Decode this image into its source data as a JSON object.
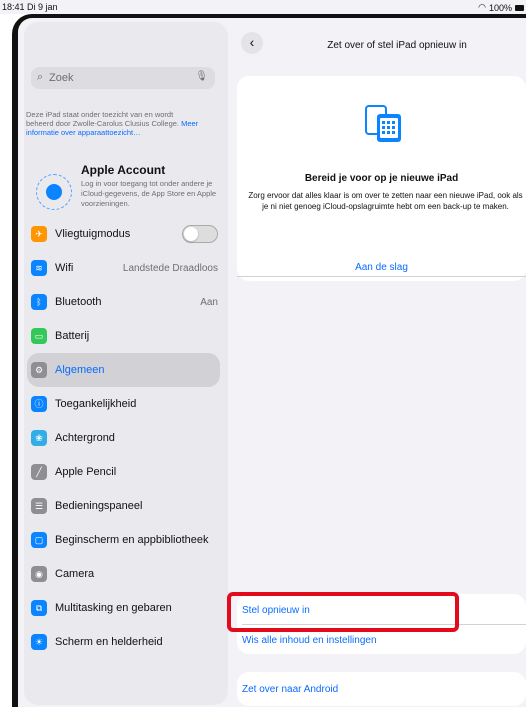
{
  "statusbar": {
    "time": "18:41",
    "date": "Di 9 jan",
    "battery": "100%"
  },
  "sidebar": {
    "search_placeholder": "Zoek",
    "supervision_text": "Deze iPad staat onder toezicht van en wordt beheerd door Zwolle-Carolus Clusius College.",
    "supervision_link": "Meer informatie over apparaattoezicht…",
    "account_title": "Apple Account",
    "account_desc": "Log in voor toegang tot onder andere je iCloud-gegevens, de App Store en Apple voorzieningen.",
    "items": [
      {
        "label": "Vliegtuigmodus",
        "value": "",
        "icon": "airplane-icon",
        "color": "#ff9500"
      },
      {
        "label": "Wifi",
        "value": "Landstede Draadloos",
        "icon": "wifi-icon",
        "color": "#0a84ff"
      },
      {
        "label": "Bluetooth",
        "value": "Aan",
        "icon": "bluetooth-icon",
        "color": "#0a84ff"
      },
      {
        "label": "Batterij",
        "value": "",
        "icon": "battery-icon",
        "color": "#34c759"
      },
      {
        "label": "Algemeen",
        "value": "",
        "icon": "gear-icon",
        "color": "#8e8e93"
      },
      {
        "label": "Toegankelijkheid",
        "value": "",
        "icon": "accessibility-icon",
        "color": "#0a84ff"
      },
      {
        "label": "Achtergrond",
        "value": "",
        "icon": "wallpaper-icon",
        "color": "#32ade6"
      },
      {
        "label": "Apple Pencil",
        "value": "",
        "icon": "pencil-icon",
        "color": "#8e8e93"
      },
      {
        "label": "Bedieningspaneel",
        "value": "",
        "icon": "control-center-icon",
        "color": "#8e8e93"
      },
      {
        "label": "Beginscherm en appbibliotheek",
        "value": "",
        "icon": "home-screen-icon",
        "color": "#0a84ff"
      },
      {
        "label": "Camera",
        "value": "",
        "icon": "camera-icon",
        "color": "#8e8e93"
      },
      {
        "label": "Multitasking en gebaren",
        "value": "",
        "icon": "multitasking-icon",
        "color": "#0a84ff"
      },
      {
        "label": "Scherm en helderheid",
        "value": "",
        "icon": "display-icon",
        "color": "#0a84ff"
      }
    ]
  },
  "main": {
    "title": "Zet over of stel iPad opnieuw in",
    "prep_title": "Bereid je voor op je nieuwe iPad",
    "prep_body": "Zorg ervoor dat alles klaar is om over te zetten naar een nieuwe iPad, ook als je ni niet genoeg iCloud-opslagruimte hebt om een back-up te maken.",
    "get_started": "Aan de slag",
    "reset": "Stel opnieuw in",
    "erase_all": "Wis alle inhoud en instellingen",
    "transfer_android": "Zet over naar Android"
  }
}
